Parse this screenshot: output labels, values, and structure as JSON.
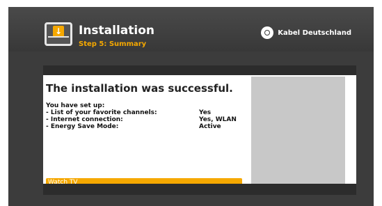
{
  "header": {
    "title": "Installation",
    "step": "Step 5: Summary",
    "brand": "Kabel Deutschland"
  },
  "summary": {
    "headline": "The installation was successful.",
    "intro": "You have set up:",
    "rows": [
      {
        "label": "- List of your favorite channels:",
        "value": "Yes"
      },
      {
        "label": "- Internet connection:",
        "value": "Yes, WLAN"
      },
      {
        "label": "- Energy Save Mode:",
        "value": "Active"
      }
    ],
    "watch_button": "Watch TV"
  },
  "colors": {
    "accent": "#f5a800",
    "background": "#3c3c3c",
    "panel": "#ffffff",
    "side_panel": "#c8c8c8"
  },
  "icons": [
    "install-icon",
    "kabel-deutschland-logo-icon"
  ]
}
